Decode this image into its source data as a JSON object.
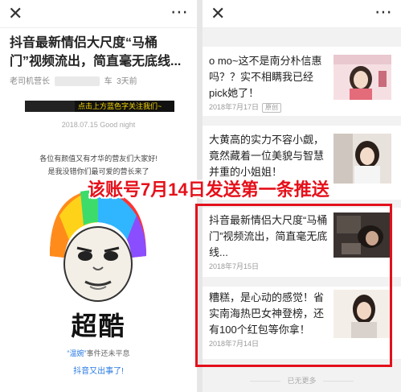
{
  "left": {
    "close_icon": "✕",
    "more_icon": "⋯",
    "title": "抖音最新情侣大尺度“马桶门”视频流出，简直毫无底线...",
    "meta_author": "老司机营长",
    "meta_suffix": "车",
    "meta_time": "3天前",
    "follow_text": "点击上方蓝色字关注我们~",
    "date_line": "2018.07.15 Good night",
    "greeting1": "各位有颜值又有才华的营友们大家好!",
    "greeting2": "是我没错你们最可爱的营长来了",
    "meme_caption": "超酷",
    "event_prefix": "“温婉”",
    "event_rest": "事件还未平息",
    "event2": "抖音又出事了!"
  },
  "right": {
    "close_icon": "✕",
    "more_icon": "⋯",
    "cards": [
      {
        "title": "o mo~这不是南分朴信惠吗？？实不相瞒我已经pick她了！",
        "date": "2018年7月17日",
        "tag": "原创"
      },
      {
        "title": "大黄高的实力不容小觑，竟然藏着一位美貌与智慧并重的小姐姐！",
        "date": "",
        "tag": ""
      },
      {
        "title": "抖音最新情侣大尺度“马桶门”视频流出，简直毫无底线...",
        "date": "2018年7月15日",
        "tag": ""
      },
      {
        "title": "糟糕，是心动的感觉！省实南海热巴女神登榜，还有100个红包等你拿！",
        "date": "2018年7月14日",
        "tag": ""
      }
    ],
    "no_more": "已无更多"
  },
  "overlay": {
    "banner": "该账号7月14日发送第一条推送"
  },
  "colors": {
    "highlight_red": "#e3101c",
    "link_blue": "#2a7ae2",
    "follow_yellow": "#f6d500"
  }
}
